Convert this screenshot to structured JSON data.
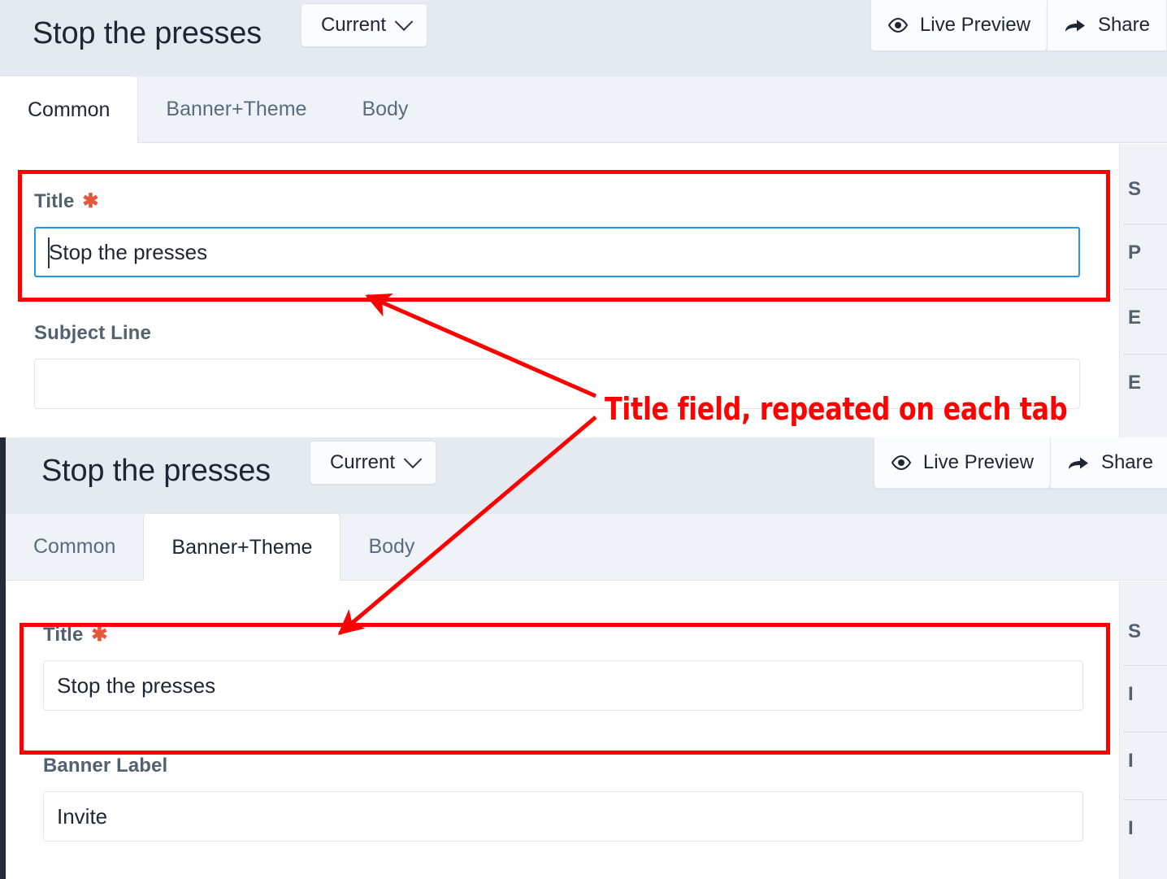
{
  "panels": [
    {
      "id": "panel-common",
      "header": {
        "title": "Stop the presses",
        "version_label": "Current",
        "live_preview_label": "Live Preview",
        "share_label": "Share"
      },
      "tabs": [
        {
          "label": "Common",
          "active": true
        },
        {
          "label": "Banner+Theme",
          "active": false
        },
        {
          "label": "Body",
          "active": false
        }
      ],
      "fields": [
        {
          "label": "Title",
          "required": true,
          "value": "Stop the presses",
          "focused": true,
          "placeholder": ""
        },
        {
          "label": "Subject Line",
          "required": false,
          "value": "",
          "focused": false,
          "placeholder": ""
        }
      ],
      "side_rail": [
        "S",
        "P",
        "E",
        "E"
      ]
    },
    {
      "id": "panel-banner-theme",
      "header": {
        "title": "Stop the presses",
        "version_label": "Current",
        "live_preview_label": "Live Preview",
        "share_label": "Share"
      },
      "tabs": [
        {
          "label": "Common",
          "active": false
        },
        {
          "label": "Banner+Theme",
          "active": true
        },
        {
          "label": "Body",
          "active": false
        }
      ],
      "fields": [
        {
          "label": "Title",
          "required": true,
          "value": "Stop the presses",
          "focused": false,
          "placeholder": ""
        },
        {
          "label": "Banner Label",
          "required": false,
          "value": "Invite",
          "focused": false,
          "placeholder": ""
        }
      ],
      "side_rail": [
        "S",
        "I",
        "I",
        "I"
      ]
    }
  ],
  "annotation": {
    "text": "Title field, repeated on each tab",
    "color": "#fe0000"
  },
  "icons": {
    "version_chevron": "chevron-down-icon",
    "live_preview": "eye-icon",
    "share": "share-arrow-icon"
  },
  "colors": {
    "header_bg": "#e5eaf1",
    "tabstrip_bg": "#eff3f7",
    "accent_focus": "#2196e3",
    "required_star": "#e8563c",
    "annotation_red": "#fe0000",
    "panel_left_border": "#222c39"
  }
}
